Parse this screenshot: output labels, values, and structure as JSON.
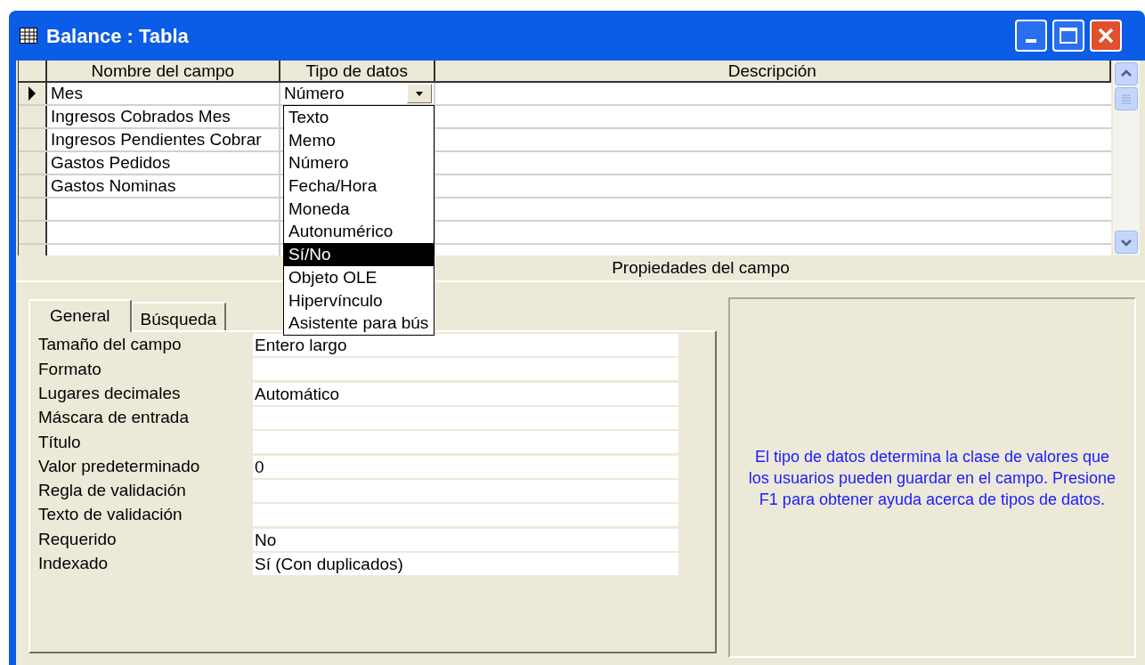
{
  "window": {
    "title": "Balance : Tabla"
  },
  "grid": {
    "columns": [
      "Nombre del campo",
      "Tipo de datos",
      "Descripción"
    ],
    "rows": [
      {
        "name": "Mes",
        "type": "Número",
        "current": true
      },
      {
        "name": "Ingresos Cobrados Mes",
        "current": false
      },
      {
        "name": "Ingresos Pendientes Cobrar",
        "current": false
      },
      {
        "name": "Gastos Pedidos",
        "current": false
      },
      {
        "name": "Gastos Nominas",
        "current": false
      }
    ]
  },
  "dropdown": {
    "options": [
      {
        "label": "Texto",
        "selected": false
      },
      {
        "label": "Memo",
        "selected": false
      },
      {
        "label": "Número",
        "selected": false
      },
      {
        "label": "Fecha/Hora",
        "selected": false
      },
      {
        "label": "Moneda",
        "selected": false
      },
      {
        "label": "Autonumérico",
        "selected": false
      },
      {
        "label": "Sí/No",
        "selected": true
      },
      {
        "label": "Objeto OLE",
        "selected": false
      },
      {
        "label": "Hipervínculo",
        "selected": false
      },
      {
        "label": "Asistente para bús",
        "selected": false
      }
    ]
  },
  "properties_heading": "Propiedades del campo",
  "tabs": [
    {
      "label": "General",
      "selected": true
    },
    {
      "label": "Búsqueda",
      "selected": false
    }
  ],
  "properties": [
    {
      "label": "Tamaño del campo",
      "value": "Entero largo"
    },
    {
      "label": "Formato"
    },
    {
      "label": "Lugares decimales",
      "value": "Automático"
    },
    {
      "label": "Máscara de entrada"
    },
    {
      "label": "Título"
    },
    {
      "label": "Valor predeterminado",
      "value": "0"
    },
    {
      "label": "Regla de validación"
    },
    {
      "label": "Texto de validación"
    },
    {
      "label": "Requerido",
      "value": "No"
    },
    {
      "label": "Indexado",
      "value": "Sí (Con duplicados)"
    }
  ],
  "help_text": "El tipo de datos determina la clase de valores que los usuarios pueden guardar en el campo. Presione F1 para obtener ayuda acerca de tipos de datos."
}
